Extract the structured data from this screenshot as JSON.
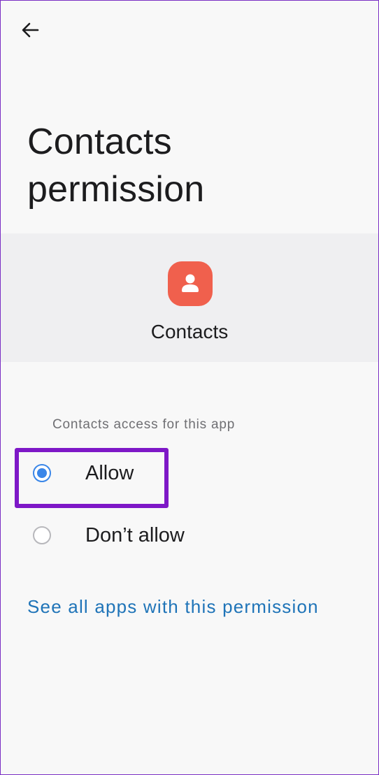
{
  "header": {
    "back_icon": "arrow-left-icon"
  },
  "page": {
    "title": "Contacts permission"
  },
  "app": {
    "name": "Contacts",
    "icon": "contacts-person-icon",
    "icon_color": "#f0604d"
  },
  "permission": {
    "section_label": "Contacts access for this app",
    "options": [
      {
        "label": "Allow",
        "selected": true
      },
      {
        "label": "Don’t allow",
        "selected": false
      }
    ],
    "accent_color": "#3a86e8"
  },
  "footer": {
    "see_all_link": "See all apps with this permission",
    "link_color": "#1f74b8"
  },
  "annotation": {
    "highlight_color": "#7e18c7"
  }
}
